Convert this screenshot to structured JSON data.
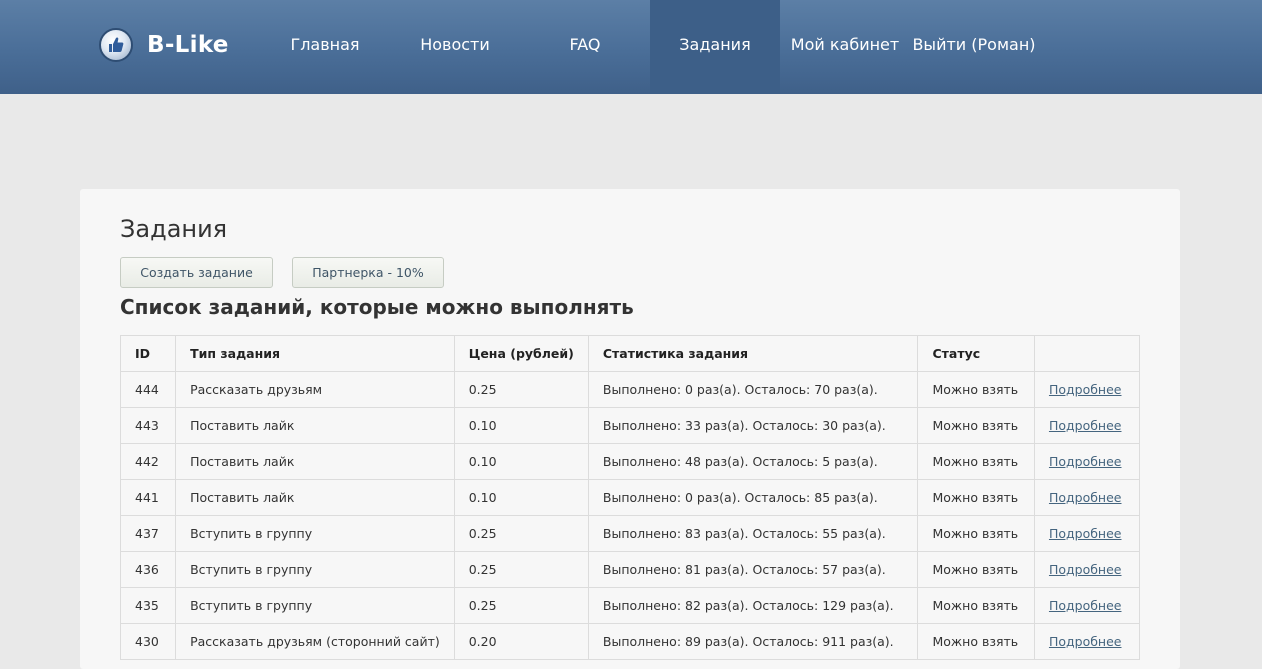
{
  "header": {
    "logo_text": "B-Like",
    "nav": [
      {
        "label": "Главная"
      },
      {
        "label": "Новости"
      },
      {
        "label": "FAQ"
      },
      {
        "label": "Задания"
      },
      {
        "label": "Мой кабинет"
      },
      {
        "label": "Выйти (Роман)"
      }
    ],
    "active_nav": "Задания"
  },
  "main": {
    "title": "Задания",
    "buttons": {
      "create": "Создать задание",
      "partner": "Партнерка - 10%"
    },
    "subtitle": "Список заданий, которые можно выполнять",
    "table": {
      "headers": [
        "ID",
        "Тип задания",
        "Цена (рублей)",
        "Статистика задания",
        "Статус",
        ""
      ],
      "rows": [
        {
          "id": "444",
          "type": "Рассказать друзьям",
          "price": "0.25",
          "stats": "Выполнено: 0 раз(а). Осталось: 70 раз(а).",
          "status": "Можно взять",
          "link": "Подробнее"
        },
        {
          "id": "443",
          "type": "Поставить лайк",
          "price": "0.10",
          "stats": "Выполнено: 33 раз(а). Осталось: 30 раз(а).",
          "status": "Можно взять",
          "link": "Подробнее"
        },
        {
          "id": "442",
          "type": "Поставить лайк",
          "price": "0.10",
          "stats": "Выполнено: 48 раз(а). Осталось: 5 раз(а).",
          "status": "Можно взять",
          "link": "Подробнее"
        },
        {
          "id": "441",
          "type": "Поставить лайк",
          "price": "0.10",
          "stats": "Выполнено: 0 раз(а). Осталось: 85 раз(а).",
          "status": "Можно взять",
          "link": "Подробнее"
        },
        {
          "id": "437",
          "type": "Вступить в группу",
          "price": "0.25",
          "stats": "Выполнено: 83 раз(а). Осталось: 55 раз(а).",
          "status": "Можно взять",
          "link": "Подробнее"
        },
        {
          "id": "436",
          "type": "Вступить в группу",
          "price": "0.25",
          "stats": "Выполнено: 81 раз(а). Осталось: 57 раз(а).",
          "status": "Можно взять",
          "link": "Подробнее"
        },
        {
          "id": "435",
          "type": "Вступить в группу",
          "price": "0.25",
          "stats": "Выполнено: 82 раз(а). Осталось: 129 раз(а).",
          "status": "Можно взять",
          "link": "Подробнее"
        },
        {
          "id": "430",
          "type": "Рассказать друзьям (сторонний сайт)",
          "price": "0.20",
          "stats": "Выполнено: 89 раз(а). Осталось: 911 раз(а).",
          "status": "Можно взять",
          "link": "Подробнее"
        }
      ]
    }
  }
}
